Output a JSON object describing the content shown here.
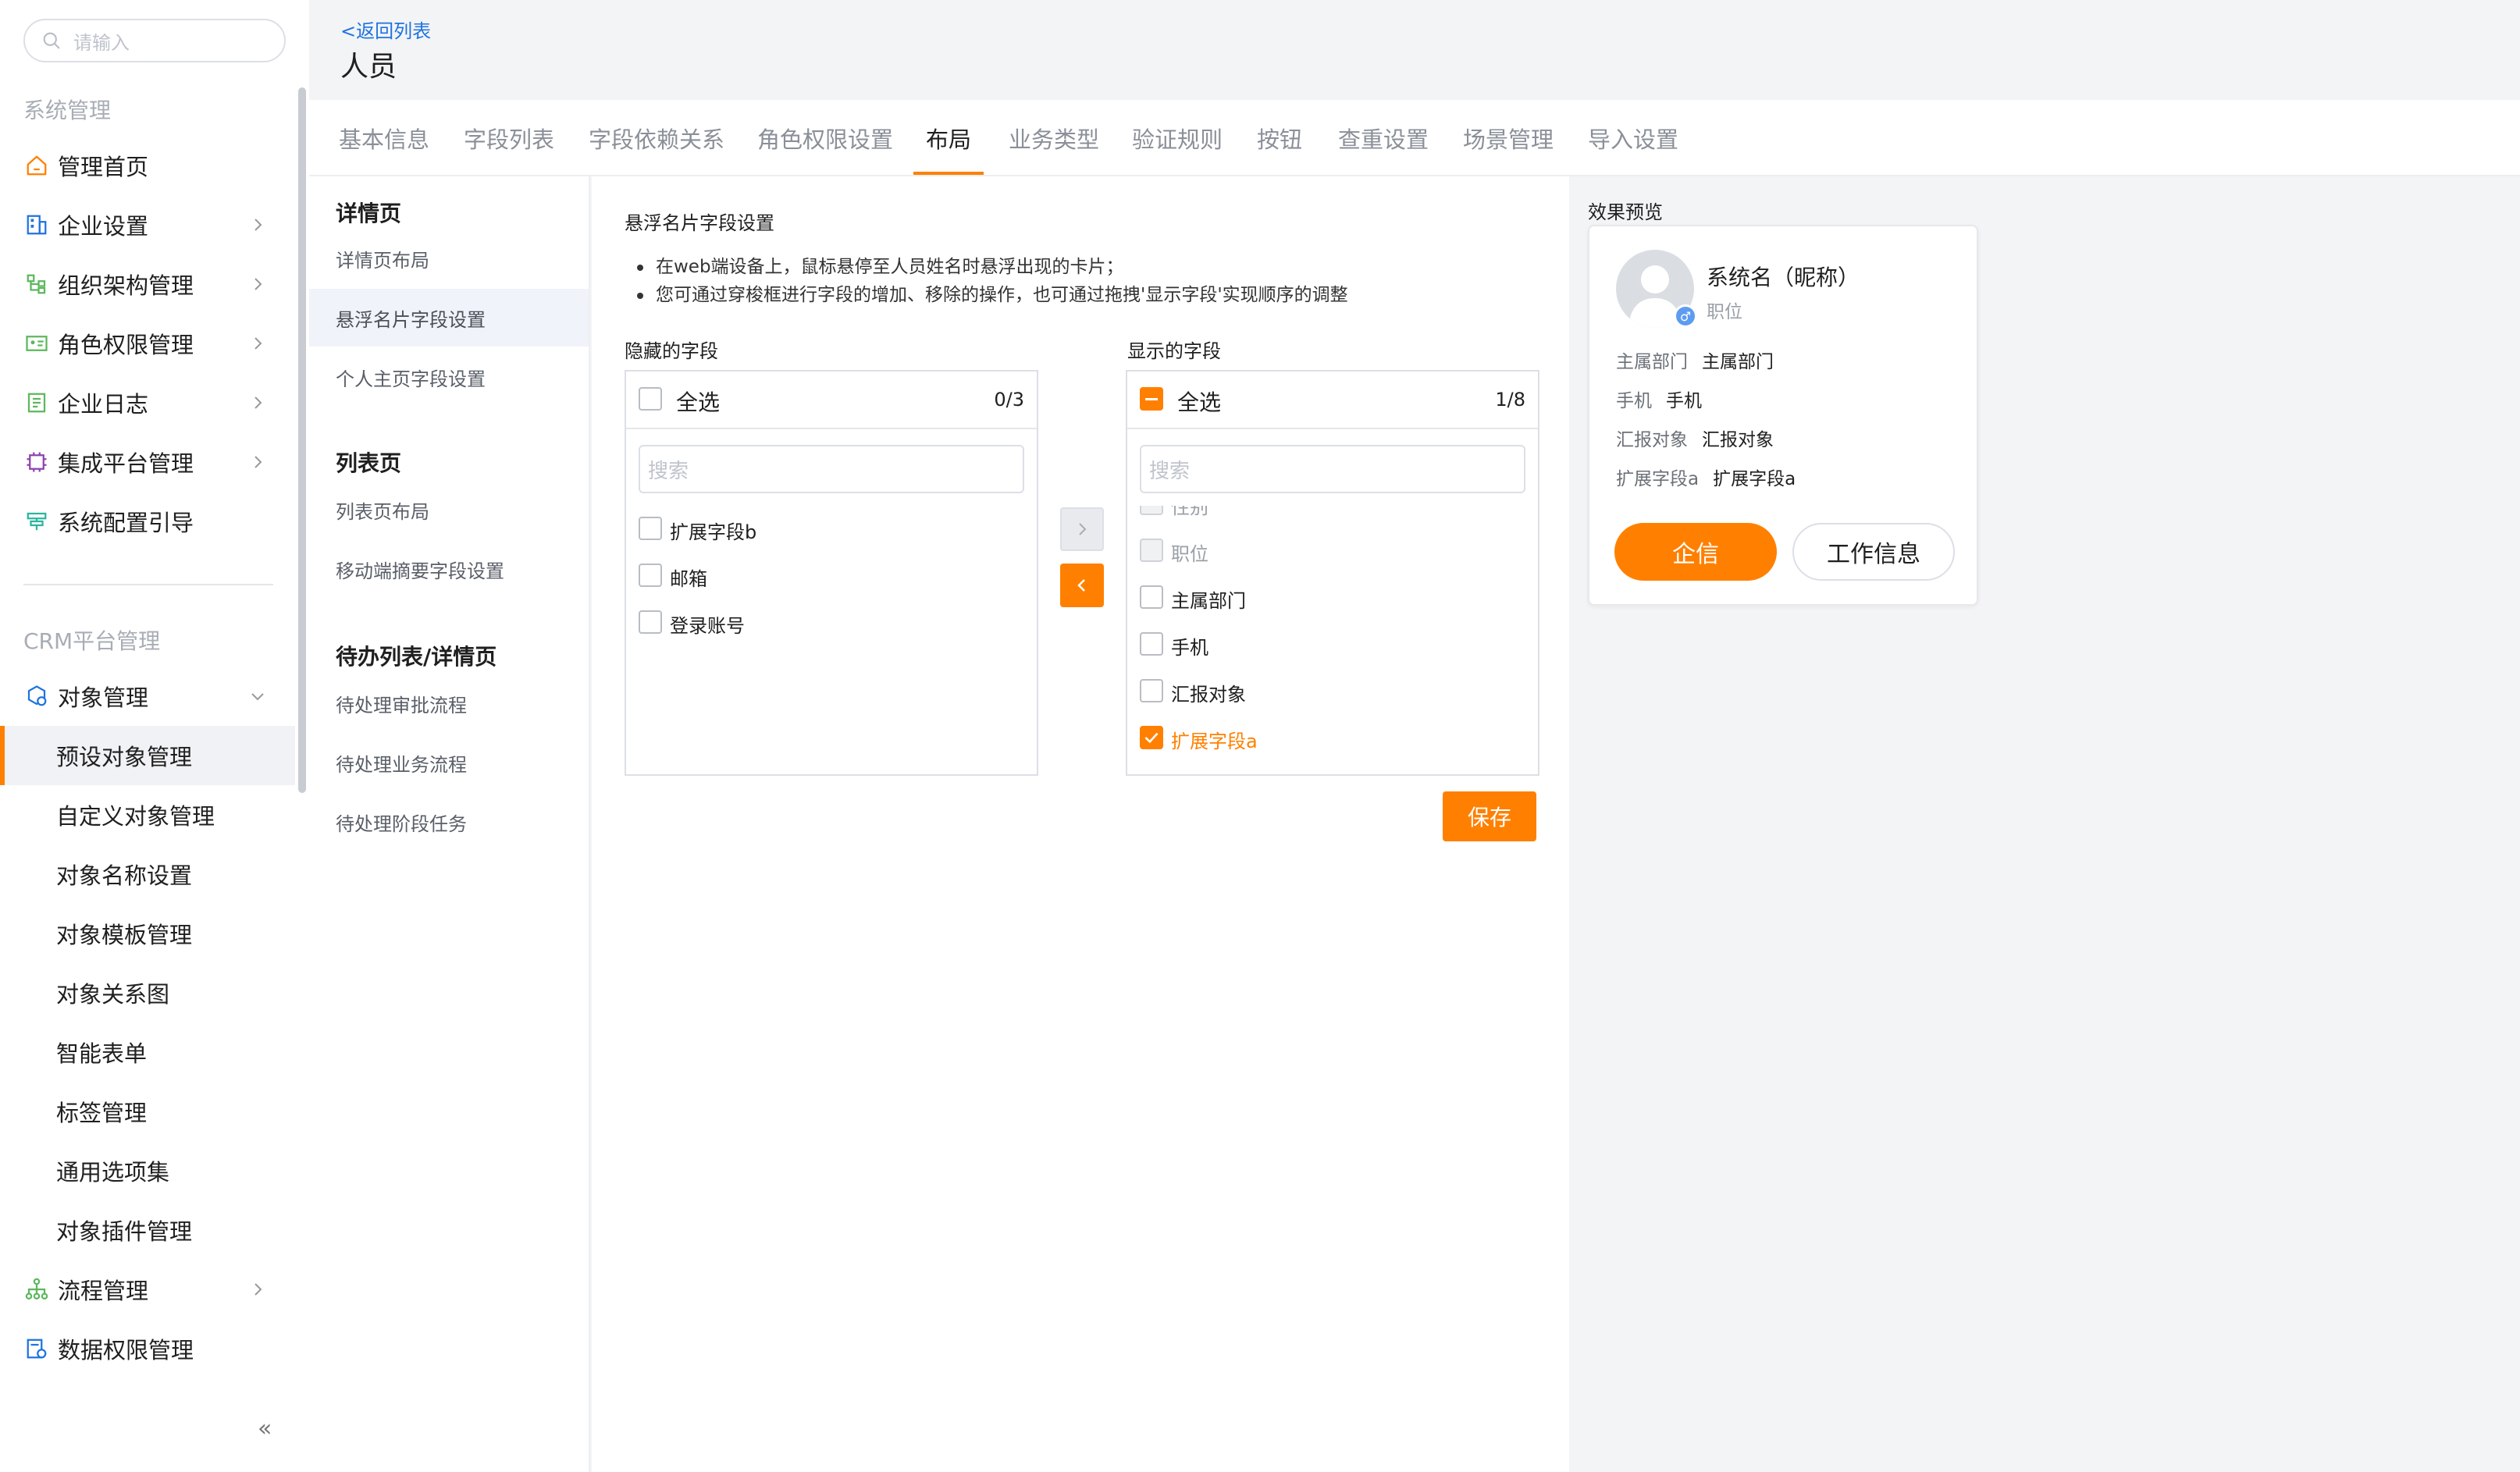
{
  "sidebar": {
    "search_placeholder": "请输入",
    "group1_title": "系统管理",
    "group1_items": [
      {
        "label": "管理首页",
        "icon": "home-icon"
      },
      {
        "label": "企业设置",
        "icon": "building-icon"
      },
      {
        "label": "组织架构管理",
        "icon": "org-tree-icon"
      },
      {
        "label": "角色权限管理",
        "icon": "id-card-icon"
      },
      {
        "label": "企业日志",
        "icon": "log-icon"
      },
      {
        "label": "集成平台管理",
        "icon": "chip-icon"
      },
      {
        "label": "系统配置引导",
        "icon": "signpost-icon"
      }
    ],
    "group2_title": "CRM平台管理",
    "object_manage": "对象管理",
    "sub_items": [
      "预设对象管理",
      "自定义对象管理",
      "对象名称设置",
      "对象模板管理",
      "对象关系图",
      "智能表单",
      "标签管理",
      "通用选项集",
      "对象插件管理"
    ],
    "flow_manage": "流程管理",
    "data_perm": "数据权限管理",
    "collapse": "«"
  },
  "header": {
    "back": "<返回列表",
    "title": "人员"
  },
  "tabs": [
    "基本信息",
    "字段列表",
    "字段依赖关系",
    "角色权限设置",
    "布局",
    "业务类型",
    "验证规则",
    "按钮",
    "查重设置",
    "场景管理",
    "导入设置"
  ],
  "active_tab": "布局",
  "menu": {
    "detail_head": "详情页",
    "detail_items": [
      "详情页布局",
      "悬浮名片字段设置",
      "个人主页字段设置"
    ],
    "list_head": "列表页",
    "list_items": [
      "列表页布局",
      "移动端摘要字段设置"
    ],
    "todo_head": "待办列表/详情页",
    "todo_items": [
      "待处理审批流程",
      "待处理业务流程",
      "待处理阶段任务"
    ]
  },
  "content": {
    "section_title": "悬浮名片字段设置",
    "tips": [
      "在web端设备上，鼠标悬停至人员姓名时悬浮出现的卡片；",
      "您可通过穿梭框进行字段的增加、移除的操作，也可通过拖拽'显示字段'实现顺序的调整"
    ],
    "hidden_label": "隐藏的字段",
    "shown_label": "显示的字段",
    "select_all": "全选",
    "hidden_count": "0/3",
    "shown_count": "1/8",
    "search_placeholder": "搜索",
    "hidden_fields": [
      "扩展字段b",
      "邮箱",
      "登录账号"
    ],
    "shown_fields": [
      "性别",
      "职位",
      "主属部门",
      "手机",
      "汇报对象",
      "扩展字段a"
    ],
    "save": "保存"
  },
  "preview": {
    "label": "效果预览",
    "name": "系统名（昵称）",
    "role": "职位",
    "fields": [
      {
        "k": "主属部门",
        "v": "主属部门"
      },
      {
        "k": "手机",
        "v": "手机"
      },
      {
        "k": "汇报对象",
        "v": "汇报对象"
      },
      {
        "k": "扩展字段a",
        "v": "扩展字段a"
      }
    ],
    "btn_primary": "企信",
    "btn_secondary": "工作信息"
  },
  "colors": {
    "accent": "#ff8000",
    "link": "#1f73e0"
  }
}
